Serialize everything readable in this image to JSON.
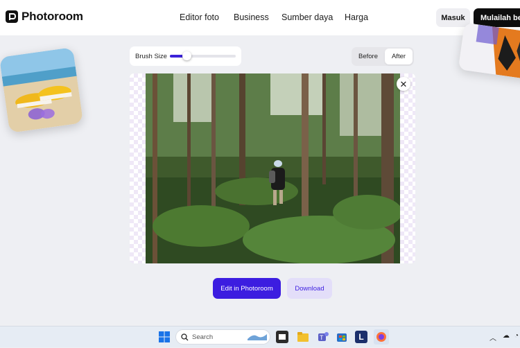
{
  "header": {
    "logo_text": "Photoroom",
    "nav": [
      "Editor foto",
      "Business",
      "Sumber daya",
      "Harga"
    ],
    "login_label": "Masuk",
    "cta_label": "Mulailah berkreasi"
  },
  "editor": {
    "brush_label": "Brush Size",
    "brush_value_percent": 25,
    "compare": {
      "before_label": "Before",
      "after_label": "After",
      "selected": "After"
    },
    "close_icon": "close-icon"
  },
  "actions": {
    "edit_label": "Edit in Photoroom",
    "download_label": "Download"
  },
  "taskbar": {
    "search_placeholder": "Search",
    "pinned_L": "L"
  },
  "colors": {
    "accent": "#3c1de0",
    "accent_soft": "#e3def9",
    "nav_bg": "#ffffff",
    "page_bg": "#eeeff3"
  }
}
